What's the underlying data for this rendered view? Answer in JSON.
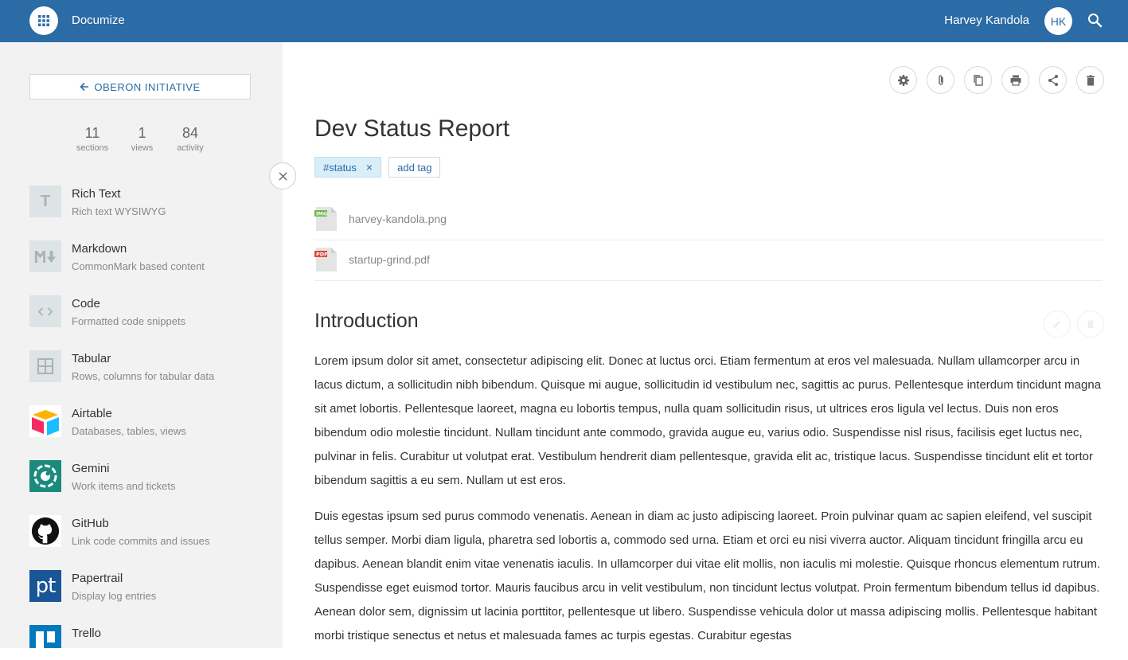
{
  "header": {
    "app_name": "Documize",
    "user_name": "Harvey Kandola",
    "user_initials": "HK",
    "icons": [
      "apps-grid-icon",
      "search-icon"
    ],
    "bar_color": "#2b6ba6"
  },
  "sidebar": {
    "back_label": "OBERON INITIATIVE",
    "stats": [
      {
        "value": "11",
        "label": "sections"
      },
      {
        "value": "1",
        "label": "views"
      },
      {
        "value": "84",
        "label": "activity"
      }
    ],
    "sections": [
      {
        "title": "Rich Text",
        "desc": "Rich text WYSIWYG",
        "icon": "rich-text-icon"
      },
      {
        "title": "Markdown",
        "desc": "CommonMark based content",
        "icon": "markdown-icon"
      },
      {
        "title": "Code",
        "desc": "Formatted code snippets",
        "icon": "code-icon"
      },
      {
        "title": "Tabular",
        "desc": "Rows, columns for tabular data",
        "icon": "table-icon"
      },
      {
        "title": "Airtable",
        "desc": "Databases, tables, views",
        "icon": "airtable-icon"
      },
      {
        "title": "Gemini",
        "desc": "Work items and tickets",
        "icon": "gemini-icon"
      },
      {
        "title": "GitHub",
        "desc": "Link code commits and issues",
        "icon": "github-icon"
      },
      {
        "title": "Papertrail",
        "desc": "Display log entries",
        "icon": "papertrail-icon"
      },
      {
        "title": "Trello",
        "desc": "",
        "icon": "trello-icon"
      }
    ]
  },
  "document": {
    "title": "Dev Status Report",
    "tags": [
      "#status"
    ],
    "add_tag_label": "add tag",
    "attachments": [
      {
        "name": "harvey-kandola.png",
        "type": "IMG"
      },
      {
        "name": "startup-grind.pdf",
        "type": "PDF"
      }
    ],
    "toolbar_icons": [
      "settings-icon",
      "attachment-icon",
      "copy-icon",
      "print-icon",
      "share-icon",
      "delete-icon"
    ],
    "section": {
      "heading": "Introduction",
      "paragraphs": [
        "Lorem ipsum dolor sit amet, consectetur adipiscing elit. Donec at luctus orci. Etiam fermentum at eros vel malesuada. Nullam ullamcorper arcu in lacus dictum, a sollicitudin nibh bibendum. Quisque mi augue, sollicitudin id vestibulum nec, sagittis ac purus. Pellentesque interdum tincidunt magna sit amet lobortis. Pellentesque laoreet, magna eu lobortis tempus, nulla quam sollicitudin risus, ut ultrices eros ligula vel lectus. Duis non eros bibendum odio molestie tincidunt. Nullam tincidunt ante commodo, gravida augue eu, varius odio. Suspendisse nisl risus, facilisis eget luctus nec, pulvinar in felis. Curabitur ut volutpat erat. Vestibulum hendrerit diam pellentesque, gravida elit ac, tristique lacus. Suspendisse tincidunt elit et tortor bibendum sagittis a eu sem. Nullam ut est eros.",
        "Duis egestas ipsum sed purus commodo venenatis. Aenean in diam ac justo adipiscing laoreet. Proin pulvinar quam ac sapien eleifend, vel suscipit tellus semper. Morbi diam ligula, pharetra sed lobortis a, commodo sed urna. Etiam et orci eu nisi viverra auctor. Aliquam tincidunt fringilla arcu eu dapibus. Aenean blandit enim vitae venenatis iaculis. In ullamcorper dui vitae elit mollis, non iaculis mi molestie. Quisque rhoncus elementum rutrum. Suspendisse eget euismod tortor. Mauris faucibus arcu in velit vestibulum, non tincidunt lectus volutpat. Proin fermentum bibendum tellus id dapibus. Aenean dolor sem, dignissim ut lacinia porttitor, pellentesque ut libero. Suspendisse vehicula dolor ut massa adipiscing mollis. Pellentesque habitant morbi tristique senectus et netus et malesuada fames ac turpis egestas. Curabitur egestas"
      ]
    }
  }
}
